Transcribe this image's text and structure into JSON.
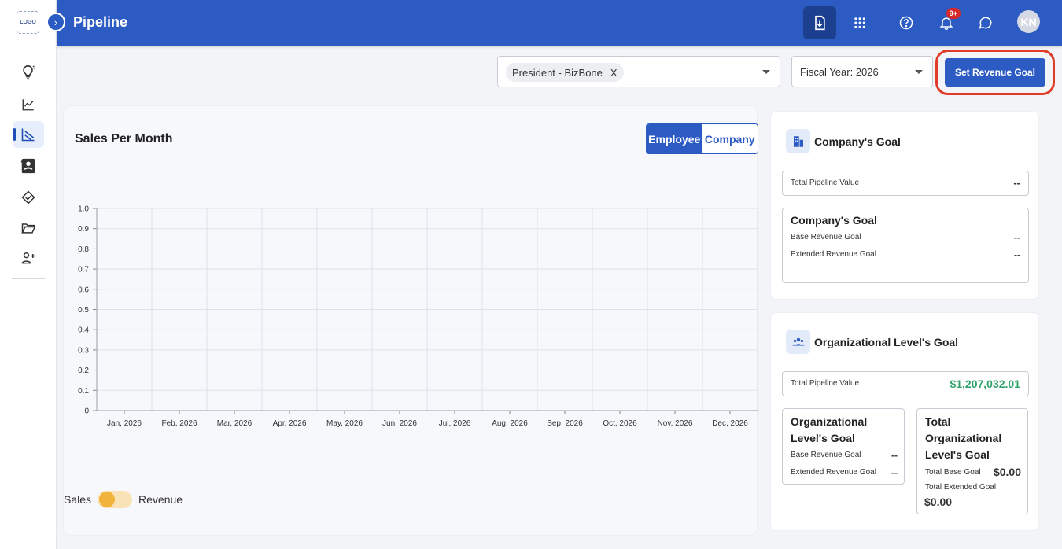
{
  "sidebar": {
    "logo": "LOGO",
    "items": [
      {
        "icon": "lightbulb-icon"
      },
      {
        "icon": "trend-chart-icon"
      },
      {
        "icon": "pipeline-chart-icon",
        "active": true
      },
      {
        "icon": "contacts-book-icon"
      },
      {
        "icon": "handshake-icon"
      },
      {
        "icon": "folder-icon"
      },
      {
        "icon": "add-user-icon"
      }
    ]
  },
  "header": {
    "title": "Pipeline",
    "notification_badge": "9+",
    "avatar_initials": "KN"
  },
  "filters": {
    "person_chip": "President - BizBone",
    "chip_remove": "X",
    "fiscal_year": "Fiscal Year: 2026",
    "set_goal_button": "Set Revenue Goal"
  },
  "chart_card": {
    "title": "Sales Per Month",
    "toggle_employee": "Employee",
    "toggle_company": "Company",
    "switch_left_label": "Sales",
    "switch_right_label": "Revenue"
  },
  "chart_data": {
    "type": "bar",
    "categories": [
      "Jan, 2026",
      "Feb, 2026",
      "Mar, 2026",
      "Apr, 2026",
      "May, 2026",
      "Jun, 2026",
      "Jul, 2026",
      "Aug, 2026",
      "Sep, 2026",
      "Oct, 2026",
      "Nov, 2026",
      "Dec, 2026"
    ],
    "values": [],
    "yticks": [
      "0",
      "0.1",
      "0.2",
      "0.3",
      "0.4",
      "0.5",
      "0.6",
      "0.7",
      "0.8",
      "0.9",
      "1.0"
    ],
    "ylim": [
      0,
      1
    ],
    "grid": true
  },
  "company_goal": {
    "title": "Company's Goal",
    "total_pipeline_label": "Total Pipeline Value",
    "total_pipeline_value": "--",
    "box_title": "Company's Goal",
    "base_label": "Base Revenue Goal",
    "base_value": "--",
    "extended_label": "Extended Revenue Goal",
    "extended_value": "--"
  },
  "org_goal": {
    "title": "Organizational Level's Goal",
    "total_pipeline_label": "Total Pipeline Value",
    "total_pipeline_value": "$1,207,032.01",
    "left_box_title_1": "Organizational",
    "left_box_title_2": "Level's Goal",
    "base_label": "Base Revenue Goal",
    "base_value": "--",
    "extended_label": "Extended Revenue Goal",
    "extended_value": "--",
    "right_box_title_1": "Total",
    "right_box_title_2": "Organizational",
    "right_box_title_3": "Level's Goal",
    "total_base_label": "Total Base Goal",
    "total_base_value": "$0.00",
    "total_extended_label": "Total Extended Goal",
    "total_extended_value": "$0.00"
  },
  "colors": {
    "primary": "#2d5bc4",
    "header_active": "#1c3f8f",
    "highlight": "#e03c28",
    "positive": "#2fa36b",
    "toggle_knob": "#f2b33d"
  }
}
